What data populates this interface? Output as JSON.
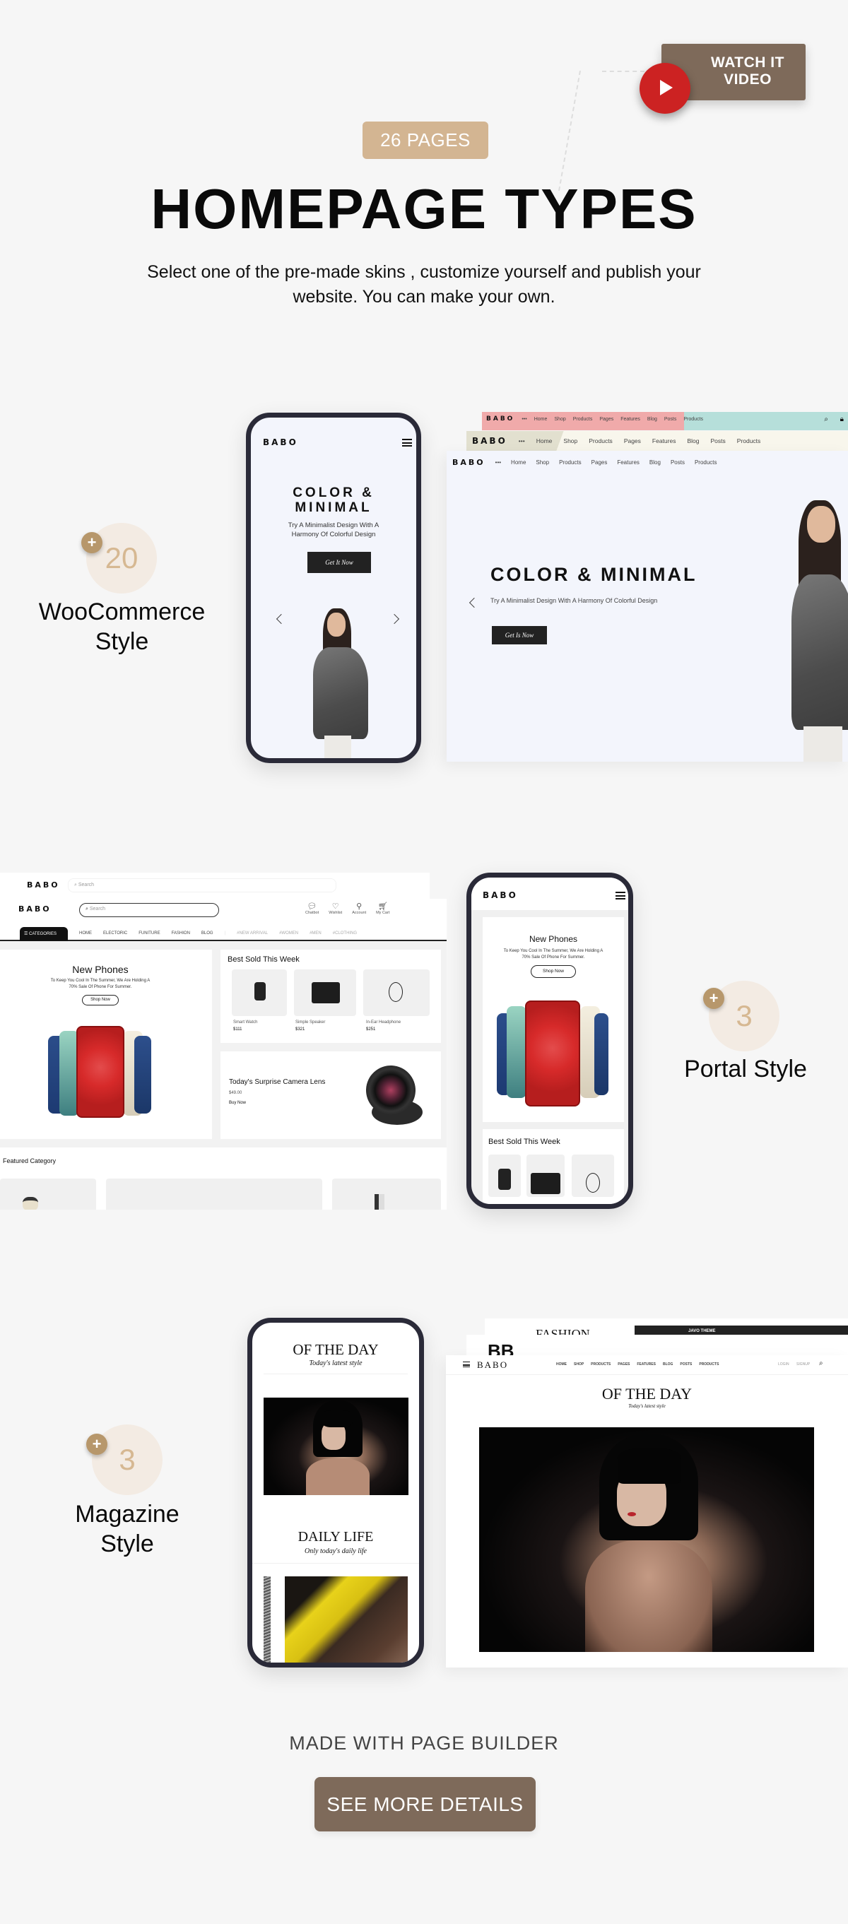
{
  "header": {
    "watch_video_label": "WATCH IT VIDEO",
    "pages_badge": "26 PAGES",
    "title": "HOMEPAGE TYPES",
    "subtitle": "Select one of the pre-made skins , customize yourself and publish your website. You can make your own."
  },
  "colors": {
    "background": "#f6f6f6",
    "brand_brown": "#7e6a5a",
    "badge_tan": "#d3b592",
    "play_red": "#cc2222",
    "count_circle": "#f3ebe3",
    "plus_gold": "#b7976b"
  },
  "sections": [
    {
      "count": "20",
      "label_line1": "WooCommerce",
      "label_line2": "Style",
      "mobile": {
        "logo": "BABO",
        "hero_title_line1": "COLOR &",
        "hero_title_line2": "MINIMAL",
        "hero_sub_line1": "Try A Minimalist Design With A",
        "hero_sub_line2": "Harmony Of Colorful Design",
        "cta": "Get It Now"
      },
      "desktop": {
        "logo": "BABO",
        "nav": [
          "Home",
          "Shop",
          "Products",
          "Pages",
          "Features",
          "Blog",
          "Posts",
          "Products"
        ],
        "hero_title": "COLOR & MINIMAL",
        "hero_sub": "Try A Minimalist Design With A Harmony Of Colorful Design",
        "cta": "Get Is Now"
      }
    },
    {
      "count": "3",
      "label": "Portal Style",
      "desktop": {
        "logo": "BABO",
        "search_placeholder": "Search",
        "header_icons": [
          "Chatbot",
          "Wishlist",
          "Account",
          "My Cart"
        ],
        "categories_label": "CATEGORIES",
        "nav": [
          "HOME",
          "ELECTORIC",
          "FUNITURE",
          "FASHION",
          "BLOG"
        ],
        "tags": [
          "#NEW ARRIVAL",
          "#WOMEN",
          "#MEN",
          "#CLOTHING"
        ],
        "promo": {
          "title": "New Phones",
          "text_line1": "To Keep You Cool In The Summer, We Are Holding A",
          "text_line2": "70% Sale Of Phone For Summer.",
          "button": "Shop Now"
        },
        "best_sold": {
          "title": "Best Sold This Week",
          "items": [
            {
              "name": "Smart Watch",
              "price": "$111"
            },
            {
              "name": "Simple Speaker",
              "price": "$321"
            },
            {
              "name": "In-Ear Headphone",
              "price": "$251"
            }
          ]
        },
        "surprise": {
          "title": "Today's Surprise Camera Lens",
          "price": "$49.00",
          "link": "Buy Now"
        },
        "featured_title": "Featured Category"
      },
      "mobile": {
        "logo": "BABO",
        "promo_title": "New Phones",
        "promo_text_line1": "To Keep You Cool In The Summer, We Are Holding A",
        "promo_text_line2": "70% Sale Of Phone For Summer.",
        "promo_button": "Shop Now",
        "best_sold_title": "Best Sold This Week"
      }
    },
    {
      "count": "3",
      "label_line1": "Magazine",
      "label_line2": "Style",
      "mobile": {
        "title1": "OF THE DAY",
        "sub1": "Today's latest style",
        "title2": "DAILY LIFE",
        "sub2": "Only today's daily life"
      },
      "desktop": {
        "back_title": "FASHION",
        "back_banner": "JAVO THEME",
        "back_logo": "BB",
        "logo": "BABO",
        "nav": [
          "HOME",
          "SHOP",
          "PRODUCTS",
          "PAGES",
          "FEATURES",
          "BLOG",
          "POSTS",
          "PRODUCTS"
        ],
        "login": "LOGIN",
        "signup": "SIGNUP",
        "title": "OF THE DAY",
        "sub": "Today's latest style"
      }
    }
  ],
  "footer": {
    "made_with": "MADE WITH PAGE BUILDER",
    "see_more": "SEE MORE DETAILS"
  }
}
